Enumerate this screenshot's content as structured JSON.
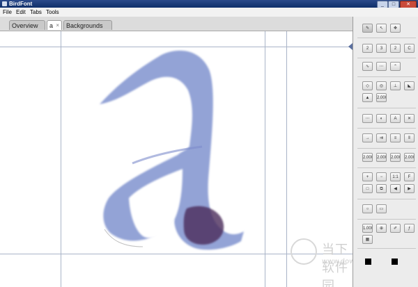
{
  "window": {
    "title": "BirdFont",
    "controls": [
      "_",
      "□",
      "✕"
    ]
  },
  "menu": {
    "items": [
      "File",
      "Edit",
      "Tabs",
      "Tools"
    ]
  },
  "tabs": [
    {
      "label": "Overview",
      "closable": false
    },
    {
      "label": "a",
      "closable": true,
      "close": "×"
    },
    {
      "label": "Backgrounds",
      "closable": false
    }
  ],
  "toolbar": {
    "kerning_labels": [
      "2",
      "3",
      "2",
      "C"
    ],
    "zoom_labels": [
      "+",
      "−",
      "1:1",
      "F"
    ],
    "numeric_labels": [
      "2.000",
      "2.000",
      "2.000",
      "2.000",
      "2.000",
      "1.000"
    ]
  },
  "watermark": {
    "text": "当下软件园",
    "url": "www.downxia.com"
  },
  "colors": {
    "ink": "#5a6fbf",
    "ink_dark": "#4a2a5a",
    "guide": "#a9b4c8"
  }
}
